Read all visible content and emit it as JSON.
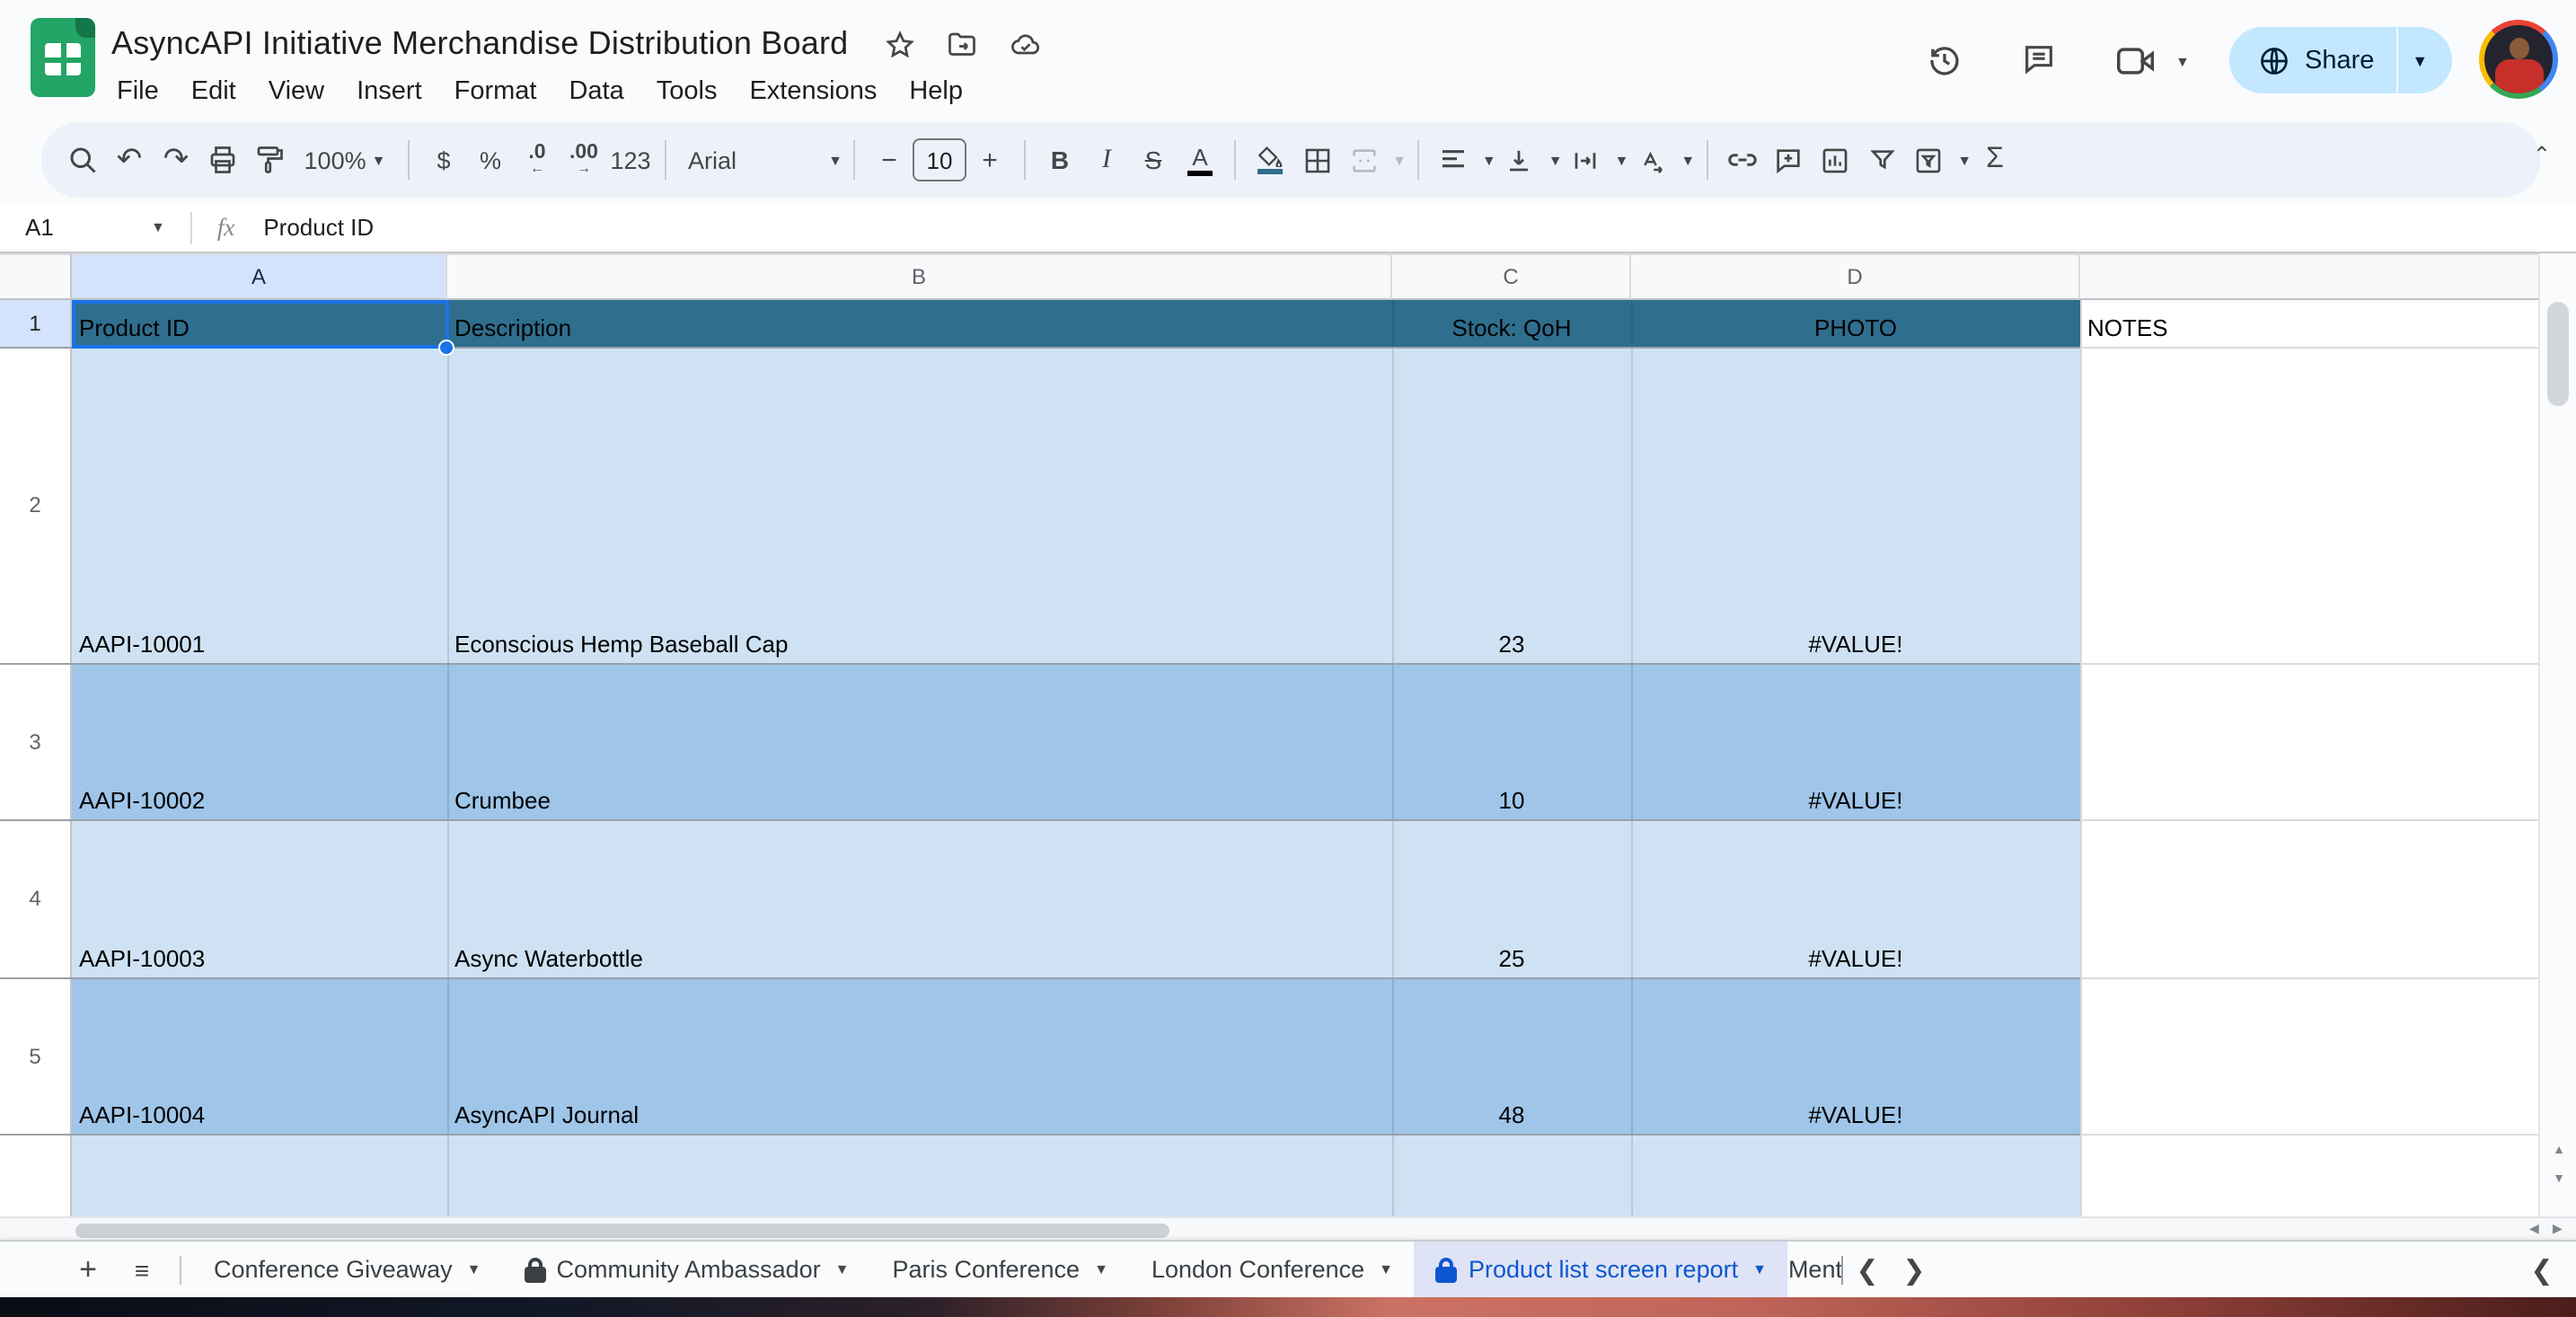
{
  "window": {
    "title": "AsyncAPI Initiative Merchandise Distribution Board"
  },
  "menu_bar": {
    "items": [
      "File",
      "Edit",
      "View",
      "Insert",
      "Format",
      "Data",
      "Tools",
      "Extensions",
      "Help"
    ]
  },
  "topbar_actions": {
    "share_label": "Share"
  },
  "toolbar": {
    "zoom_value": "100%",
    "currency": "$",
    "percent": "%",
    "decimal_decrease": ".0",
    "decimal_increase": ".00",
    "number_format": "123",
    "font_family": "Arial",
    "font_size": "10",
    "minus": "−",
    "plus": "+",
    "bold": "B",
    "italic": "I",
    "strikethrough": "S",
    "text_color": "A",
    "fill_color": "A",
    "functions": "Σ"
  },
  "formula_bar": {
    "cell_reference": "A1",
    "fx_label": "fx",
    "formula_content": "Product ID"
  },
  "grid": {
    "column_letters": {
      "a": "A",
      "b": "B",
      "c": "C",
      "d": "D"
    },
    "header_row": {
      "number": "1",
      "product_id": "Product ID",
      "description": "Description",
      "stock": "Stock: QoH",
      "photo": "PHOTO",
      "notes": "NOTES"
    },
    "rows": [
      {
        "number": "2",
        "product_id": "AAPI-10001",
        "description": "Econscious Hemp Baseball Cap",
        "stock": "23",
        "photo": "#VALUE!"
      },
      {
        "number": "3",
        "product_id": "AAPI-10002",
        "description": "Crumbee",
        "stock": "10",
        "photo": "#VALUE!"
      },
      {
        "number": "4",
        "product_id": "AAPI-10003",
        "description": "Async Waterbottle",
        "stock": "25",
        "photo": "#VALUE!"
      },
      {
        "number": "5",
        "product_id": "AAPI-10004",
        "description": "AsyncAPI Journal",
        "stock": "48",
        "photo": "#VALUE!"
      }
    ]
  },
  "sheet_tabs": {
    "add_label": "+",
    "tabs": [
      {
        "label": "Conference Giveaway",
        "locked": false,
        "active": false
      },
      {
        "label": "Community Ambassador",
        "locked": true,
        "active": false
      },
      {
        "label": "Paris Conference",
        "locked": false,
        "active": false
      },
      {
        "label": "London Conference",
        "locked": false,
        "active": false
      },
      {
        "label": "Product list screen report",
        "locked": true,
        "active": true
      },
      {
        "label": "Ment",
        "locked": false,
        "active": false,
        "truncated": true
      }
    ]
  },
  "colors": {
    "header_row_fill": "#2F6E8E",
    "row_fill_light": "#CFE2F3",
    "row_fill_dark": "#9FC5E8",
    "selection_accent": "#1A73E8",
    "selected_header_fill": "#D3E3FD",
    "share_button_fill": "#C2E7FF",
    "active_tab_bg": "#DFE3F6",
    "active_tab_text": "#0B57D0",
    "logo_green": "#23A566"
  }
}
